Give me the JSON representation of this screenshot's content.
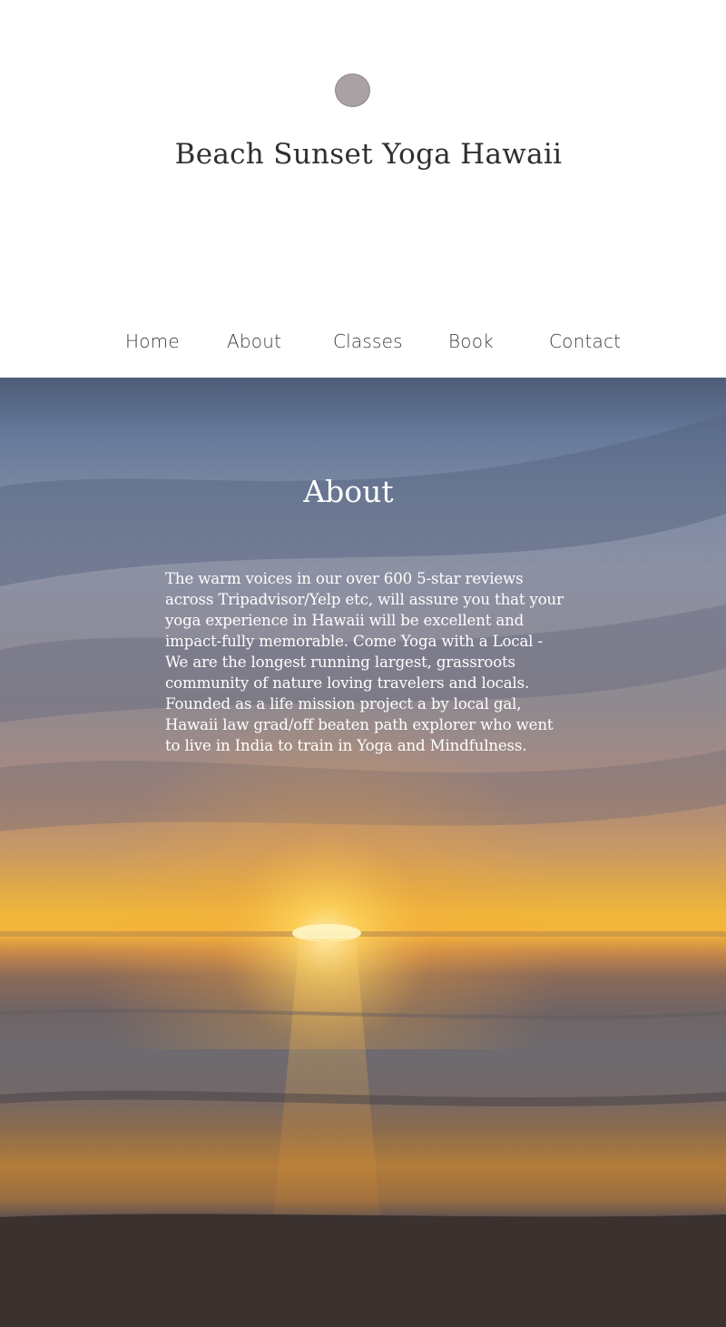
{
  "site": {
    "title": "Beach Sunset Yoga Hawaii"
  },
  "nav": {
    "items": [
      {
        "label": "Home"
      },
      {
        "label": "About"
      },
      {
        "label": "Classes"
      },
      {
        "label": "Book"
      },
      {
        "label": "Contact"
      }
    ]
  },
  "about": {
    "heading": "About",
    "body": "The warm voices in our over 600 5-star reviews across Tripadvisor/Yelp etc, will assure you that your yoga experience in Hawaii will be excellent and impact-fully memorable. Come Yoga with a Local - We are the longest running largest, grassroots community of nature loving travelers and locals. Founded as a life mission project a by local gal, Hawaii law grad/off beaten path explorer who went to live in India to train in Yoga and Mindfulness."
  },
  "colors": {
    "logo_dot": "#a9a1a3",
    "header_bg": "#ffffff",
    "hero_text": "#ffffff"
  }
}
